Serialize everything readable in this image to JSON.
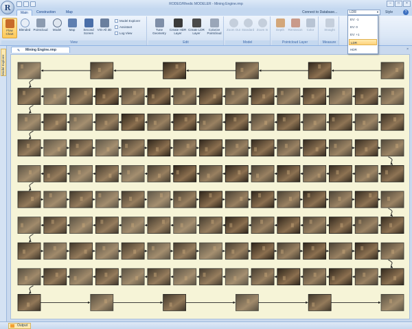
{
  "window": {
    "title": "RODEO/Rhedic MODELER - Mining Engine.rmp",
    "controls": [
      "–",
      "□",
      "×"
    ]
  },
  "ribbon_tabs": [
    {
      "label": "Main",
      "active": true
    },
    {
      "label": "Construction",
      "active": false
    },
    {
      "label": "Map",
      "active": false
    }
  ],
  "connect": {
    "label": "Connect to Database...",
    "value": "LDR",
    "style_label": "Style",
    "help_label": "?"
  },
  "db_options": [
    "EV: -1",
    "EV: 0",
    "EV: +1",
    "LDR",
    "HDR"
  ],
  "db_selected_index": 3,
  "groups": {
    "view": {
      "label": "View",
      "buttons": [
        "Flow Chart",
        "Blended",
        "Pointcloud",
        "Model",
        "Map",
        "Second Screen",
        "VIS-All 3D"
      ],
      "checks": [
        "Model Explorer",
        "Assistant",
        "Log View"
      ]
    },
    "edit": {
      "label": "Edit",
      "buttons": [
        "Tune Geometry",
        "Create HDR Layer",
        "Create LDR Layer",
        "Colorize Pointcloud"
      ]
    },
    "model": {
      "label": "Model",
      "buttons": [
        "Zoom Out",
        "Standard",
        "Zoom In"
      ]
    },
    "pointcloud_layer": {
      "label": "Pointcloud Layer",
      "buttons": [
        "Depth",
        "Remission",
        "Color"
      ]
    },
    "measure": {
      "label": "Measure",
      "buttons": [
        "Straight"
      ]
    }
  },
  "side_panel": {
    "label": "Model Explorer"
  },
  "document_tab": {
    "label": "Mining Engine.rmp",
    "close": "×"
  },
  "flow_rows": [
    {
      "count": 6,
      "direction": "left"
    },
    {
      "count": 15,
      "direction": "left"
    },
    {
      "count": 15,
      "direction": "left"
    },
    {
      "count": 15,
      "direction": "right"
    },
    {
      "count": 15,
      "direction": "left"
    },
    {
      "count": 15,
      "direction": "right"
    },
    {
      "count": 15,
      "direction": "left"
    },
    {
      "count": 15,
      "direction": "right"
    },
    {
      "count": 15,
      "direction": "left"
    },
    {
      "count": 6,
      "direction": "right"
    }
  ],
  "colors": {
    "canvas_bg": "#f6f4d7",
    "thumb_dark": "#2b2218",
    "thumb_light": "#8a6e4e",
    "connector": "#222222",
    "ribbon_selected": "#ffc95a"
  },
  "status": {
    "output_label": "Output"
  }
}
